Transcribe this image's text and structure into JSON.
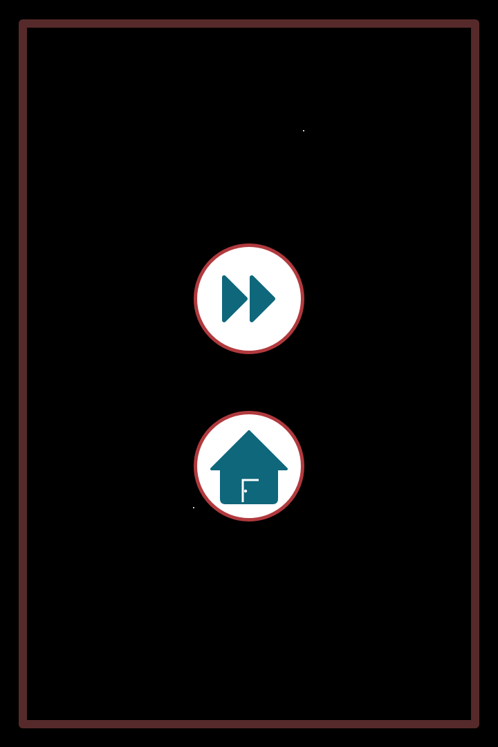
{
  "screen": {
    "name": "pause-menu",
    "colors": {
      "background": "#000000",
      "frame_border": "#562a2a",
      "button_fill": "#ffffff",
      "button_ring": "#b03a3e",
      "icon": "#0f677b"
    }
  },
  "buttons": [
    {
      "id": "fast-forward",
      "icon": "fast-forward-icon"
    },
    {
      "id": "home",
      "icon": "home-icon"
    }
  ]
}
